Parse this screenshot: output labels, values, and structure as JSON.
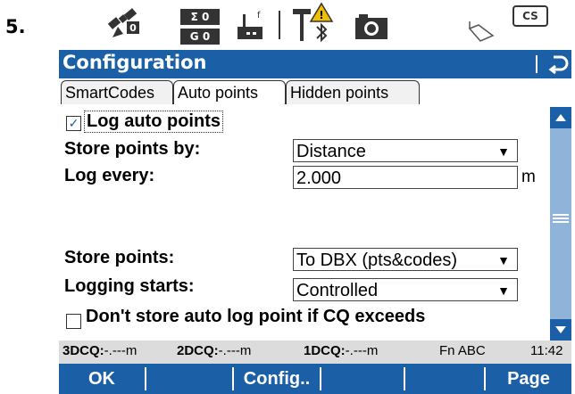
{
  "step_label": "5.",
  "status_icons": {
    "satellite": "satellite-icon",
    "sigma_top": "Σ 0",
    "sigma_bottom": "G 0",
    "radio": "radio-icon",
    "antenna": "antenna-icon",
    "bluetooth_warning": "bluetooth-warning-icon",
    "camera": "camera-icon",
    "pole": "pole-icon",
    "cs_badge": "CS"
  },
  "titlebar": {
    "title": "Configuration"
  },
  "tabs": [
    {
      "label": "SmartCodes",
      "active": false
    },
    {
      "label": "Auto points",
      "active": true
    },
    {
      "label": "Hidden points",
      "active": false
    }
  ],
  "content": {
    "log_auto_points": {
      "label": "Log auto points",
      "checked": true
    },
    "store_points_by": {
      "label": "Store points by:",
      "value": "Distance"
    },
    "log_every": {
      "label": "Log every:",
      "value": "2.000",
      "unit": "m"
    },
    "store_points": {
      "label": "Store points:",
      "value": "To DBX (pts&codes)"
    },
    "logging_starts": {
      "label": "Logging starts:",
      "value": "Controlled"
    },
    "dont_store": {
      "label": "Don't store auto log point if CQ exceeds",
      "checked": false
    }
  },
  "statusbar": {
    "cq3_label": "3DCQ:",
    "cq3_value": "-.---m",
    "cq2_label": "2DCQ:",
    "cq2_value": "-.---m",
    "cq1_label": "1DCQ:",
    "cq1_value": "-.---m",
    "mode": "Fn ABC",
    "time": "11:42"
  },
  "softkeys": {
    "f1": "OK",
    "f2": "",
    "f3": "Config..",
    "f4": "",
    "f5": "",
    "f6": "Page"
  },
  "colors": {
    "accent": "#1b5fa6",
    "scroll_track": "#8fb3d9",
    "status_bg": "#dcdcdc"
  }
}
